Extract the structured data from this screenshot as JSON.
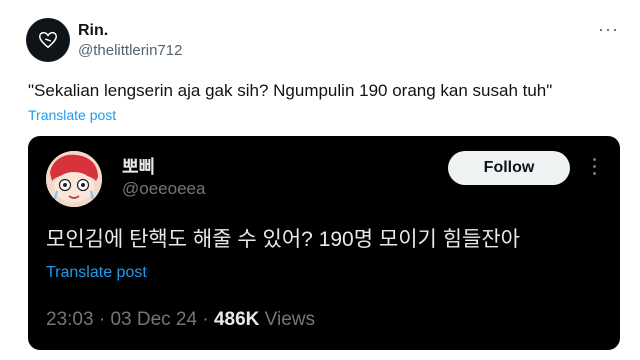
{
  "tweet": {
    "author_name": "Rin.",
    "author_handle": "@thelittlerin712",
    "more_label": "···",
    "text": "\"Sekalian lengserin aja gak sih? Ngumpulin 190 orang kan susah tuh\"",
    "translate_label": "Translate post",
    "avatar_icon": "heart-icon"
  },
  "quoted": {
    "author_name": "뽀삐",
    "author_handle": "@oeeoeea",
    "follow_label": "Follow",
    "text": "모인김에 탄핵도 해줄 수 있어? 190명 모이기 힘들잔아",
    "translate_label": "Translate post",
    "time": "23:03",
    "separator": "·",
    "date": "03 Dec 24",
    "views_count": "486K",
    "views_label": "Views"
  },
  "colors": {
    "link": "#1d9bf0",
    "quote_bg": "#000000",
    "secondary_text": "#536471",
    "dark_secondary": "#71767b"
  }
}
